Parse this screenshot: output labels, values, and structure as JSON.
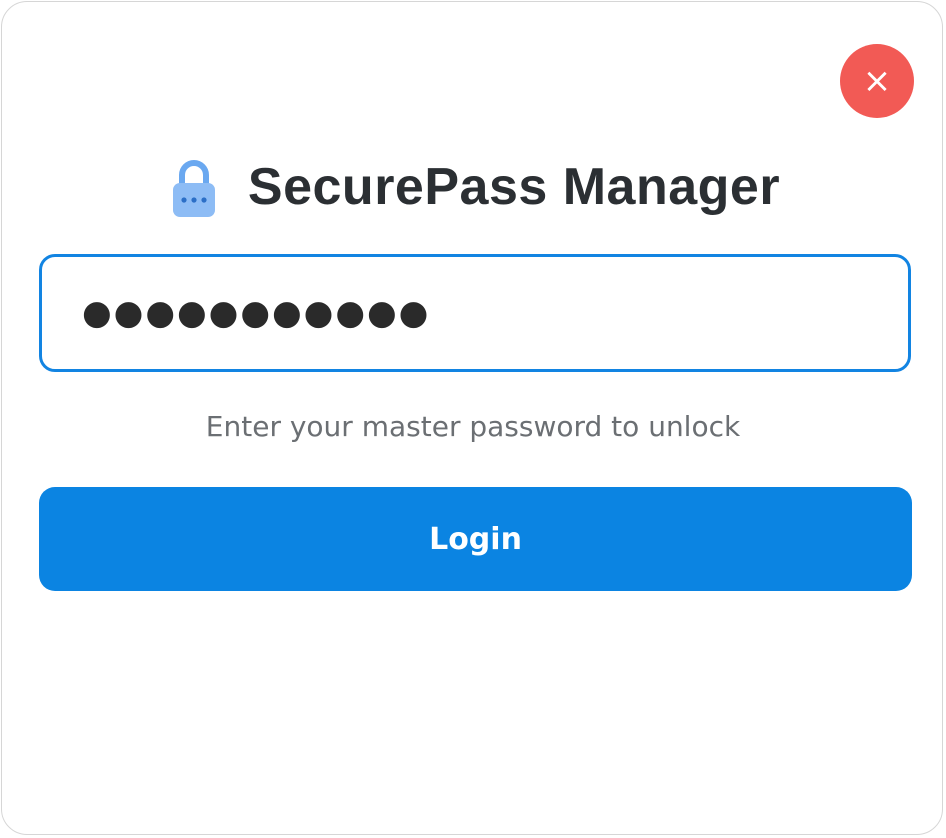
{
  "app": {
    "title": "SecurePass Manager",
    "lock_icon": "lock-icon",
    "close_icon": "close-icon",
    "close_glyph": "×"
  },
  "password": {
    "value": "●●●●●●●●●●●",
    "type": "password"
  },
  "hint": "Enter your master password to unlock",
  "login": {
    "label": "Login"
  },
  "colors": {
    "accent": "#0b84e2",
    "close": "#f25a55",
    "title": "#2b2f33"
  }
}
